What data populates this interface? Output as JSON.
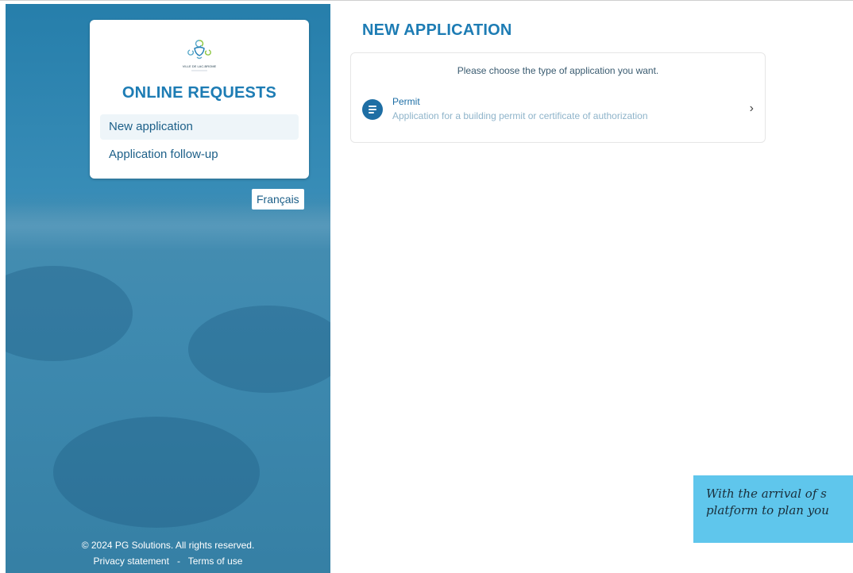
{
  "sidebar": {
    "logo_icon": "city-logo-icon",
    "logo_text": "VILLE DE LAC-BROME",
    "title": "ONLINE REQUESTS",
    "nav": [
      {
        "label": "New application",
        "active": true
      },
      {
        "label": "Application follow-up",
        "active": false
      }
    ],
    "language_button": "Français",
    "footer": {
      "copyright": "© 2024 PG Solutions. All rights reserved.",
      "privacy_link": "Privacy statement",
      "separator": "-",
      "terms_link": "Terms of use"
    }
  },
  "main": {
    "title": "NEW APPLICATION",
    "prompt": "Please choose the type of application you want.",
    "options": [
      {
        "icon": "list-icon",
        "title": "Permit",
        "description": "Application for a building permit or certificate of authorization"
      }
    ]
  },
  "promo": {
    "line1": "With the arrival of s",
    "line2": "platform to plan you"
  },
  "colors": {
    "accent": "#1d7cb4",
    "sidebar_bg": "#1f7aa8",
    "promo_bg": "#5fc6ec"
  }
}
